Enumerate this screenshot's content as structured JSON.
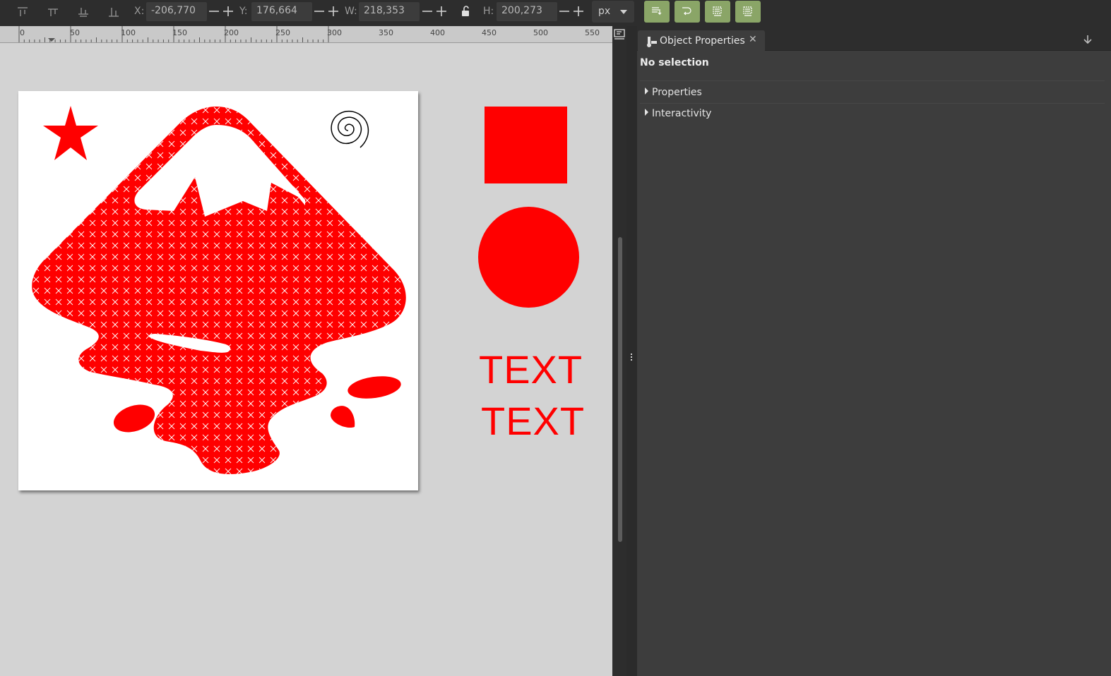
{
  "toolbar": {
    "x_label": "X:",
    "x_value": "-206,770",
    "y_label": "Y:",
    "y_value": "176,664",
    "w_label": "W:",
    "w_value": "218,353",
    "h_label": "H:",
    "h_value": "200,273",
    "unit": "px",
    "align_icons": [
      "align-top-icon",
      "align-center-vertical-icon",
      "align-bottom-icon",
      "align-baseline-icon"
    ],
    "snap_buttons": [
      "snap-to-path-icon",
      "snap-rotate-icon",
      "snap-bbox-icon",
      "snap-grid-icon"
    ],
    "accent_color": "#8aa567"
  },
  "ruler": {
    "labels": [
      "0",
      "50",
      "100",
      "150",
      "200",
      "250",
      "300",
      "350",
      "400",
      "450",
      "500",
      "550"
    ]
  },
  "canvas": {
    "background": "#d3d3d3",
    "shape_color": "#ff0000",
    "texts": [
      "TEXT",
      "TEXT"
    ]
  },
  "panel": {
    "tab_title": "Object Properties",
    "close_symbol": "✕",
    "status": "No selection",
    "sections": [
      "Properties",
      "Interactivity"
    ]
  }
}
